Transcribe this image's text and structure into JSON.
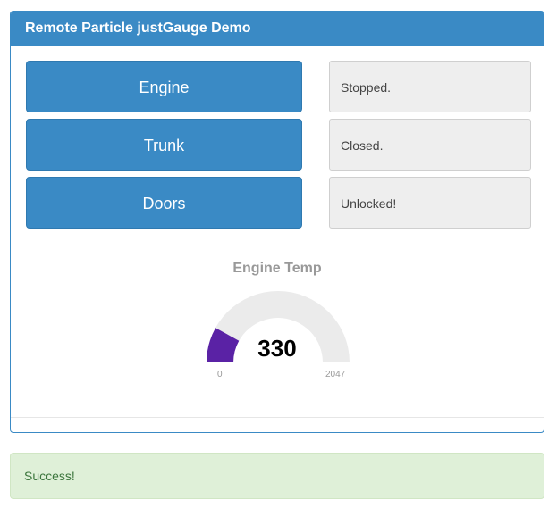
{
  "panel": {
    "title": "Remote Particle justGauge Demo"
  },
  "controls": [
    {
      "button_label": "Engine",
      "status": "Stopped."
    },
    {
      "button_label": "Trunk",
      "status": "Closed."
    },
    {
      "button_label": "Doors",
      "status": "Unlocked!"
    }
  ],
  "gauge": {
    "title": "Engine Temp",
    "value": 330,
    "value_text": "330",
    "min": 0,
    "max": 2047,
    "min_text": "0",
    "max_text": "2047",
    "level_color": "#5a22a5",
    "track_color": "#ebebeb"
  },
  "alert": {
    "text": "Success!"
  }
}
